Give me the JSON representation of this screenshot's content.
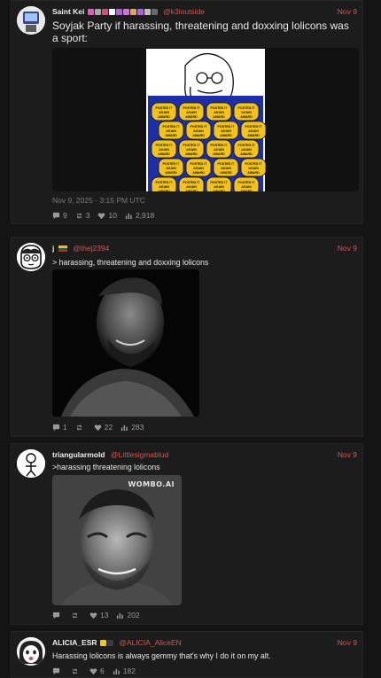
{
  "posts": [
    {
      "name": "Saint Kei",
      "handle": "@k3ioutside",
      "date": "Nov 9",
      "text": "Soyjak Party if harassing, threatening and doxxing lolicons was a sport:",
      "timestamp": "Nov 9, 2025 · 3:15 PM UTC",
      "replies": "9",
      "reposts": "3",
      "likes": "10",
      "views": "2,918",
      "media_label": "POSTED IT AGAIN AWARD",
      "emoji_colors": [
        "#e05bb7",
        "#a7a7a7",
        "#d84b7e",
        "#ffffff",
        "#b15ee0",
        "#d86be0",
        "#e0a35b",
        "#b15ee0",
        "#bdbdbd",
        "#6b6b6b"
      ]
    },
    {
      "name": "j",
      "handle": "@thej2394",
      "date": "Nov 9",
      "text": "> harassing, threatening and doxxing lolicons",
      "replies": "1",
      "reposts": "",
      "likes": "22",
      "views": "283",
      "flag_colors": [
        "#fdb913",
        "#006a44",
        "#c1272d"
      ]
    },
    {
      "name": "triangularmold",
      "handle": "@Littlesigmablud",
      "date": "Nov 9",
      "text": ">harassing threatening lolicons",
      "replies": "",
      "reposts": "",
      "likes": "13",
      "views": "202",
      "watermark": "WOMBO.AI"
    },
    {
      "name": "ALICIA_ESR",
      "handle": "@ALICIA_AliceEN",
      "date": "Nov 9",
      "text": "Harassing lolicons is always gemmy that's why I do it on my alt.",
      "replies": "",
      "reposts": "",
      "likes": "6",
      "views": "182",
      "emoji_colors": [
        "#f5c518",
        "#3a3a3a"
      ]
    }
  ],
  "colors": {
    "accent": "#d9534f",
    "award": "#f3c21b",
    "award_bg": "#1d2fa8"
  }
}
